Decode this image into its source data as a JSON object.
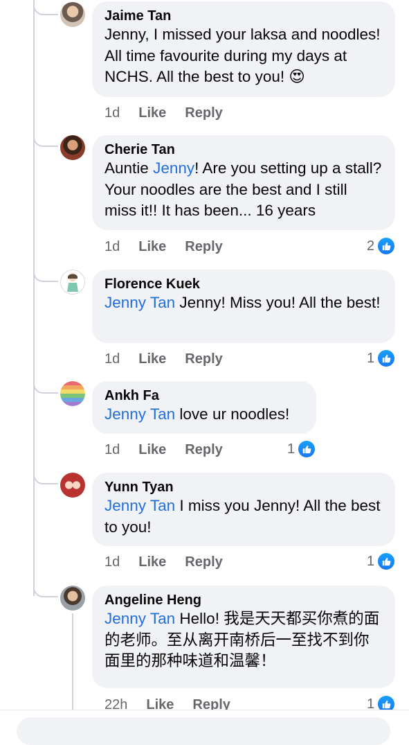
{
  "comments": [
    {
      "author": "Jaime Tan",
      "text": "Jenny, I missed your laksa and noodles! All time favourite during my days at NCHS. All the best to you! 😍",
      "time": "1d",
      "like_label": "Like",
      "reply_label": "Reply",
      "reactions": ""
    },
    {
      "author": "Cherie Tan",
      "text_before": "Auntie ",
      "mention": "Jenny",
      "text_after": "! Are you setting up a stall? Your noodles are the best and I still miss it!! It has been... 16 years",
      "time": "1d",
      "like_label": "Like",
      "reply_label": "Reply",
      "reactions": "2"
    },
    {
      "author": "Florence Kuek",
      "mention": "Jenny Tan",
      "text_after": " Jenny! Miss you! All the best!",
      "time": "1d",
      "like_label": "Like",
      "reply_label": "Reply",
      "reactions": "1"
    },
    {
      "author": "Ankh Fa",
      "mention": "Jenny Tan",
      "text_after": " love ur noodles!",
      "time": "1d",
      "like_label": "Like",
      "reply_label": "Reply",
      "reactions": "1"
    },
    {
      "author": "Yunn Tyan",
      "mention": "Jenny Tan",
      "text_after": " I miss you Jenny! All the best to you!",
      "time": "1d",
      "like_label": "Like",
      "reply_label": "Reply",
      "reactions": "1"
    },
    {
      "author": "Angeline Heng",
      "mention": "Jenny Tan",
      "text_after": " Hello! 我是天天都买你煮的面的老师。至从离开南桥后一至找不到你面里的那种味道和温馨！",
      "time": "22h",
      "like_label": "Like",
      "reply_label": "Reply",
      "reactions": "1"
    }
  ],
  "colors": {
    "mention": "#216fdb",
    "bubble": "#f0f2f5",
    "like_blue": "#1877f2"
  },
  "icons": {
    "reaction": "like-thumb-icon"
  }
}
